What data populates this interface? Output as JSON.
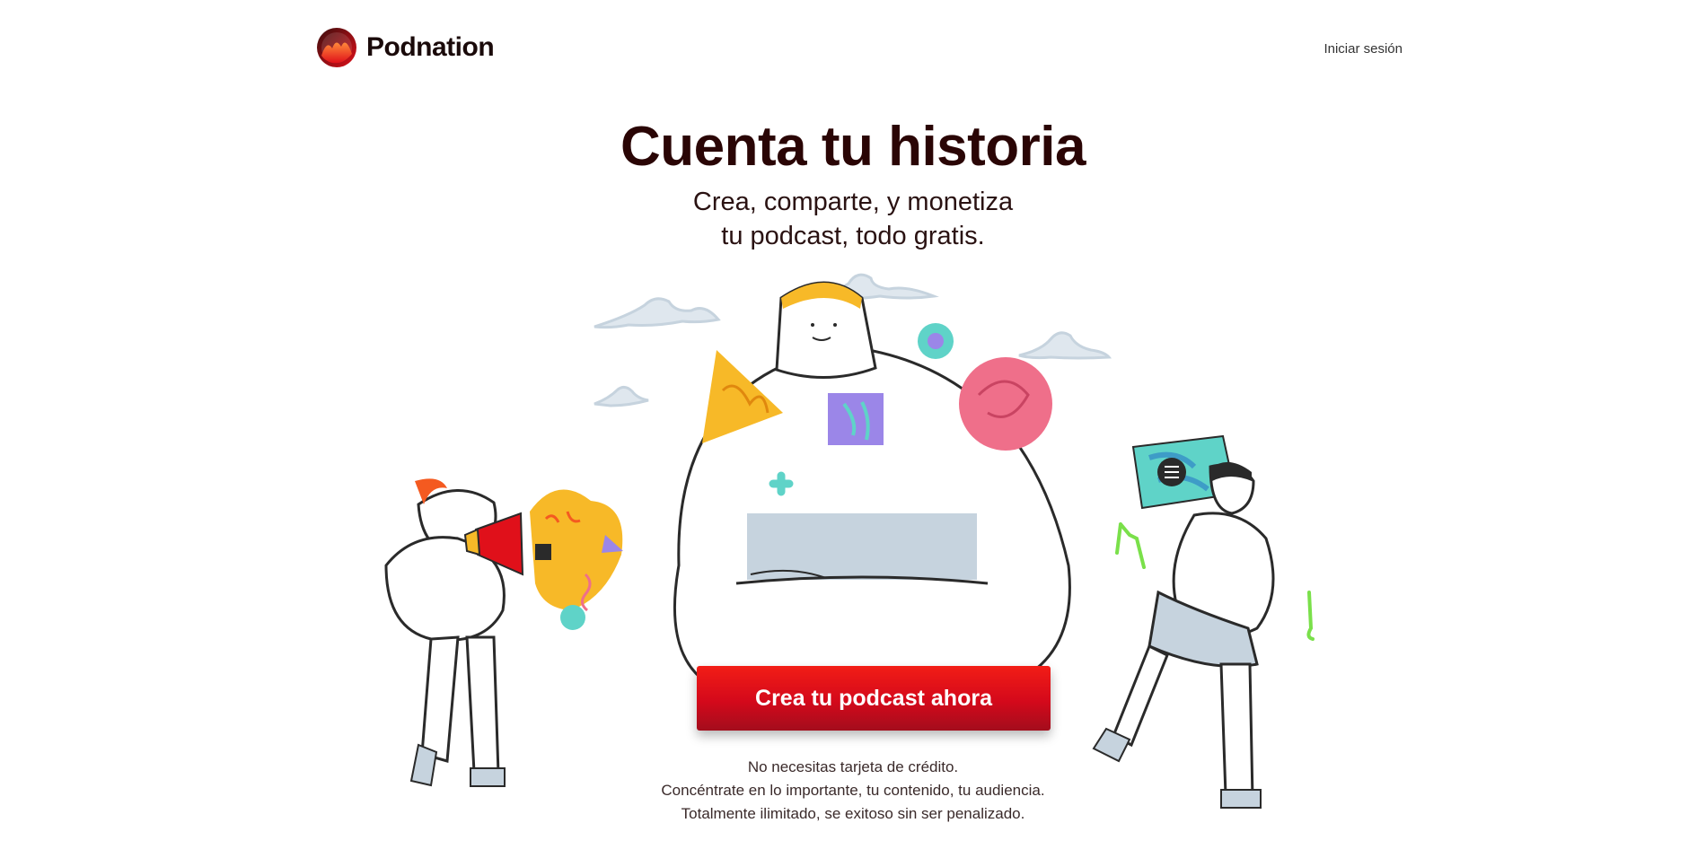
{
  "header": {
    "brand_name": "Podnation",
    "login_label": "Iniciar sesión"
  },
  "hero": {
    "title": "Cuenta tu historia",
    "subtitle_lines": [
      "Crea, comparte, y monetiza",
      "tu podcast, todo gratis."
    ]
  },
  "cta": {
    "label": "Crea tu podcast ahora"
  },
  "notes": [
    "No necesitas tarjeta de crédito.",
    "Concéntrate en lo importante, tu contenido, tu audiencia.",
    "Totalmente ilimitado, se exitoso sin ser penalizado."
  ],
  "colors": {
    "brand_red": "#e0101a",
    "title_dark": "#2a0505",
    "accent_yellow": "#f7b928",
    "accent_pink": "#ef6f8a",
    "accent_teal": "#5fd3c8",
    "accent_purple": "#9b86e8",
    "accent_green": "#7ae04a",
    "cloud_gray": "#c6d3de"
  },
  "icons": [
    "podnation-logo-icon",
    "megaphone-icon",
    "music-note-icon",
    "menu-icon"
  ]
}
